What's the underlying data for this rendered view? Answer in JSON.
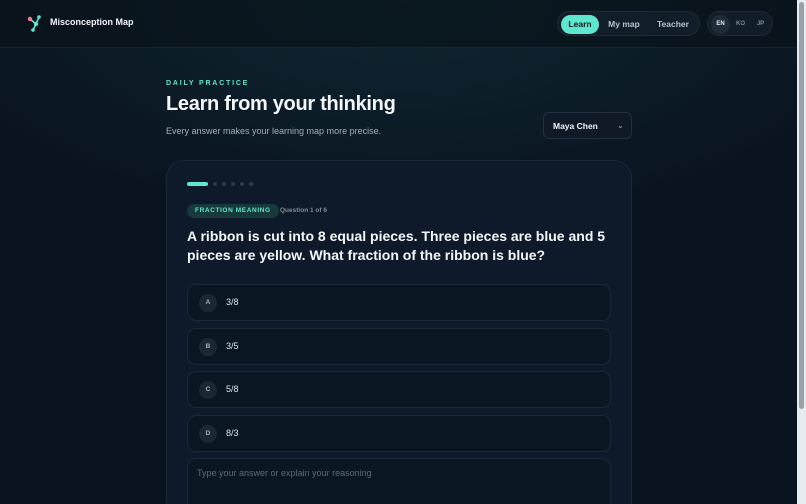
{
  "app": {
    "title": "Misconception Map"
  },
  "nav": {
    "items": [
      {
        "label": "Learn",
        "active": true
      },
      {
        "label": "My map",
        "active": false
      },
      {
        "label": "Teacher",
        "active": false
      }
    ]
  },
  "languages": [
    {
      "code": "EN",
      "active": true
    },
    {
      "code": "KO",
      "active": false
    },
    {
      "code": "JP",
      "active": false
    }
  ],
  "header": {
    "eyebrow": "DAILY PRACTICE",
    "title": "Learn from your thinking",
    "subtitle": "Every answer makes your learning map more precise."
  },
  "student_select": {
    "value": "Maya Chen",
    "icon": "chevron-down-icon"
  },
  "quiz": {
    "progress": {
      "current": 1,
      "total": 6
    },
    "topic": "FRACTION MEANING",
    "question_count": "Question 1 of 6",
    "question": "A ribbon is cut into 8 equal pieces. Three pieces are blue and 5 pieces are yellow. What fraction of the ribbon is blue?",
    "options": [
      {
        "letter": "A",
        "text": "3/8"
      },
      {
        "letter": "B",
        "text": "3/5"
      },
      {
        "letter": "C",
        "text": "5/8"
      },
      {
        "letter": "D",
        "text": "8/3"
      }
    ],
    "answer_placeholder": "Type your answer or explain your reasoning"
  },
  "colors": {
    "accent": "#5ee6cf",
    "background": "#0a1420",
    "card": "#0e1a29"
  }
}
